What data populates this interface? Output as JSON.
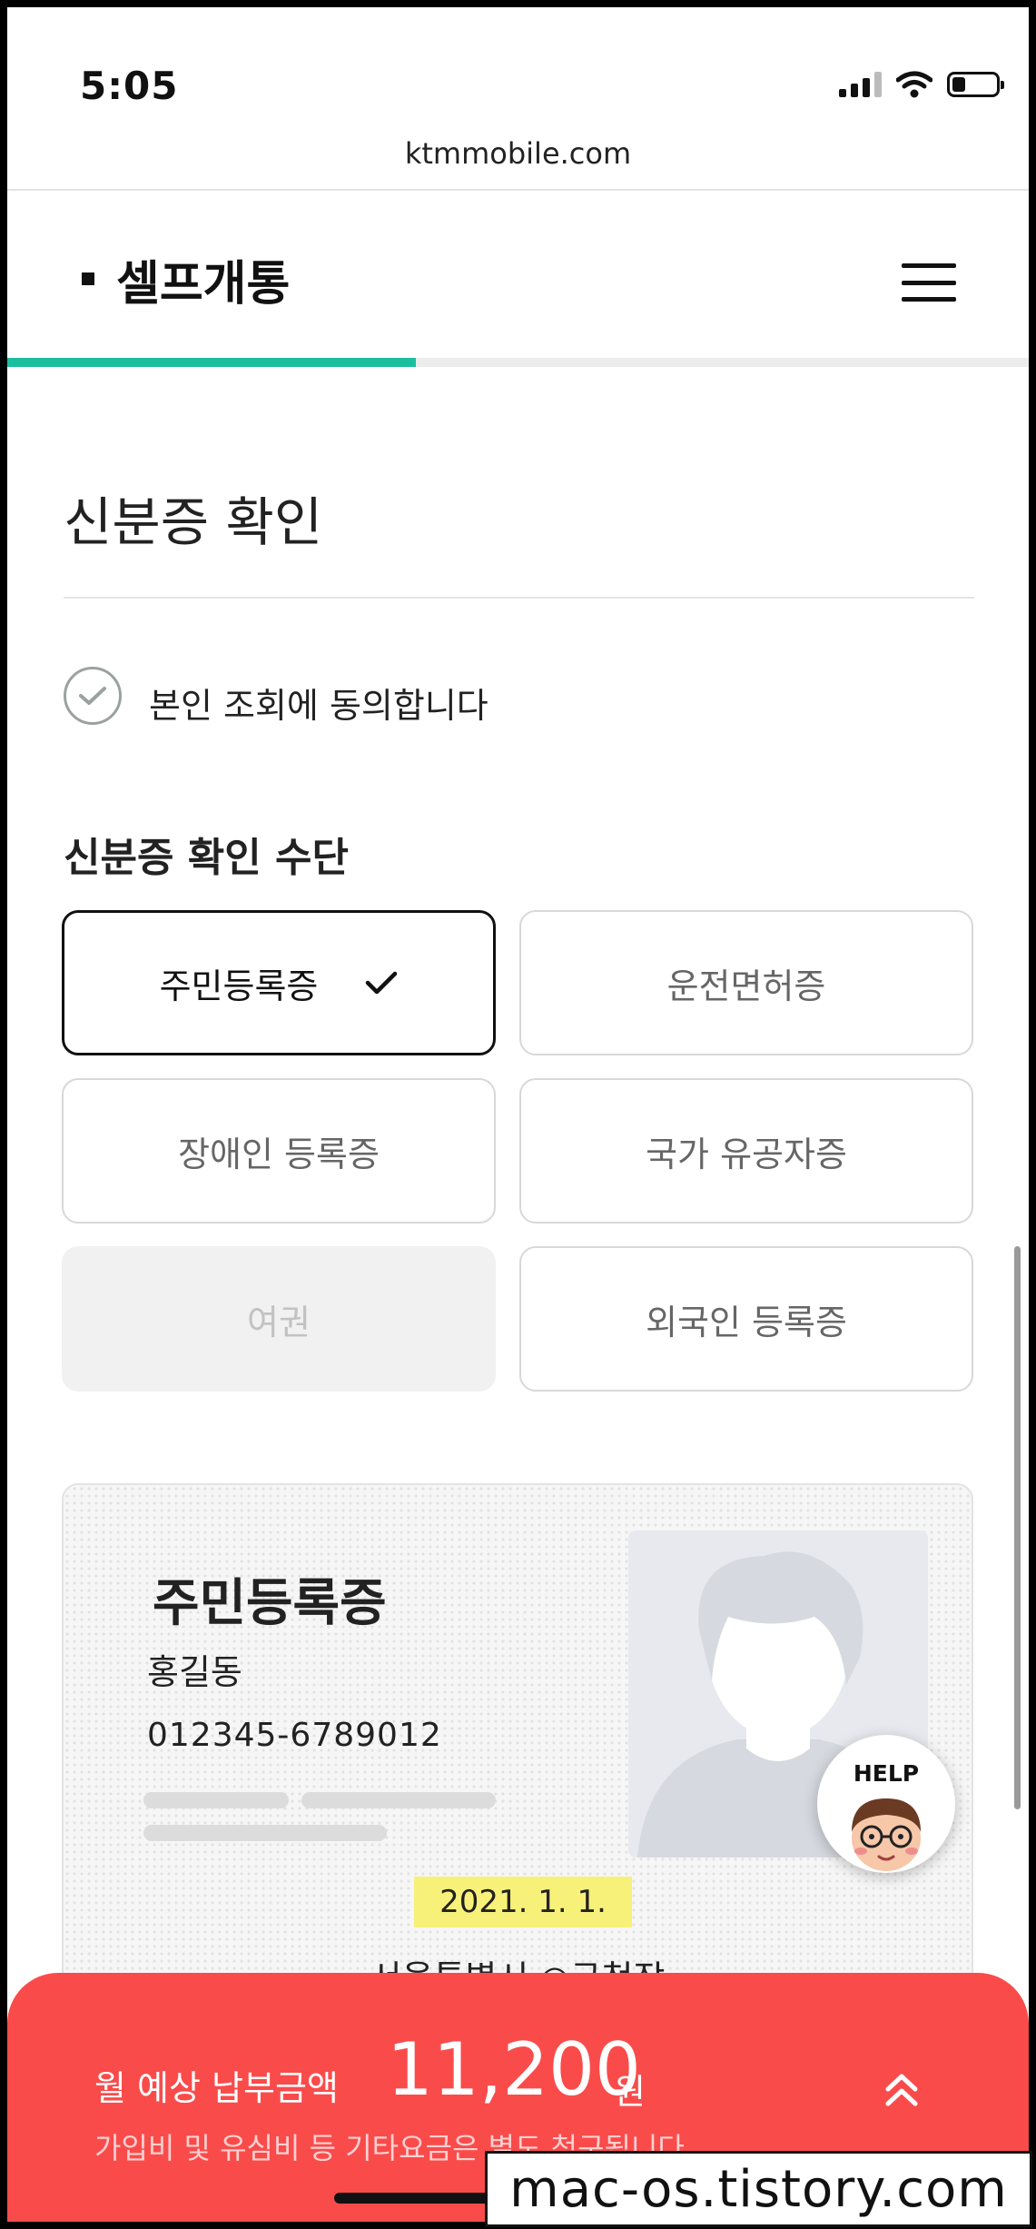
{
  "status_bar": {
    "time": "5:05"
  },
  "browser": {
    "url": "ktmmobile.com"
  },
  "header": {
    "title": "셀프개통",
    "progress_fraction": 0.4
  },
  "page": {
    "title": "신분증 확인",
    "agree_label": "본인 조회에 동의합니다",
    "method_title": "신분증 확인 수단"
  },
  "options": [
    {
      "label": "주민등록증",
      "state": "selected"
    },
    {
      "label": "운전면허증",
      "state": "normal"
    },
    {
      "label": "장애인 등록증",
      "state": "normal"
    },
    {
      "label": "국가 유공자증",
      "state": "normal"
    },
    {
      "label": "여권",
      "state": "disabled"
    },
    {
      "label": "외국인 등록증",
      "state": "normal"
    }
  ],
  "id_card": {
    "title": "주민등록증",
    "name": "홍길동",
    "number": "012345-6789012",
    "issue_date": "2021. 1. 1.",
    "issuer": "서울특별시 ○구청장"
  },
  "help_button": {
    "label": "HELP"
  },
  "bottom_bar": {
    "label": "월 예상 납부금액",
    "amount": "11,200",
    "unit": "원",
    "note": "가입비 및 유심비 등 기타요금은 별도 청구됩니다."
  },
  "watermark": "mac-os.tistory.com",
  "colors": {
    "accent": "#1bbf9f",
    "bottom_bar": "#fa4b4b",
    "highlight": "#f7f17a"
  }
}
